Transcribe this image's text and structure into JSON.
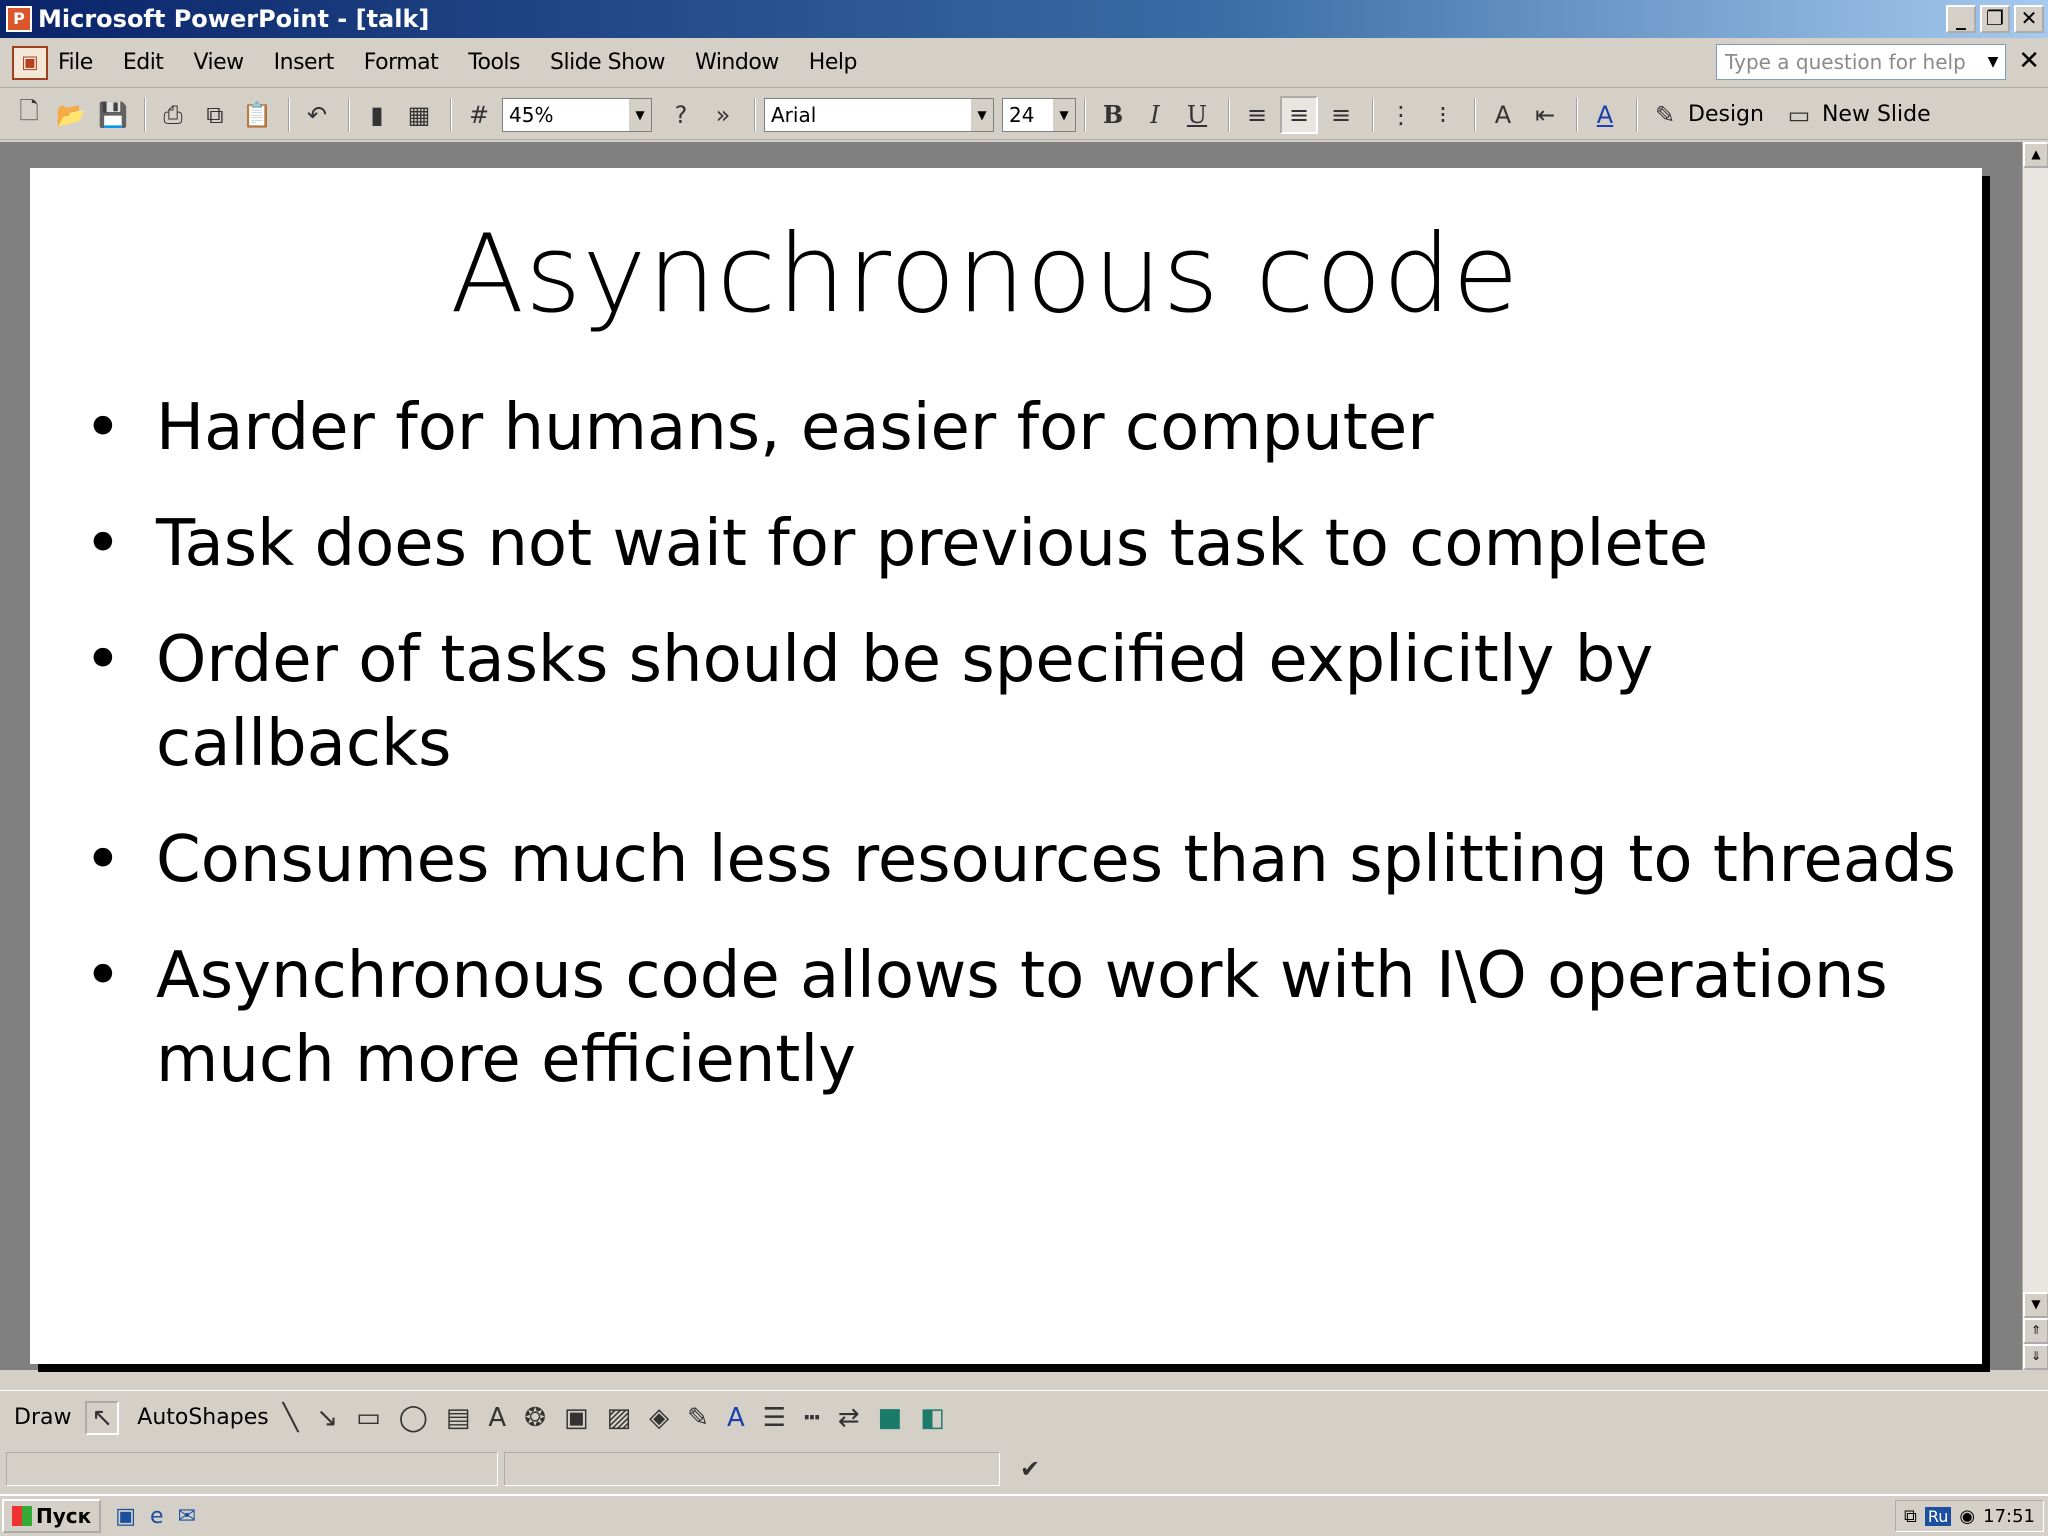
{
  "window": {
    "title": "Microsoft PowerPoint - [talk]",
    "controls": {
      "minimize": "_",
      "restore": "❐",
      "close": "✕"
    }
  },
  "menu": {
    "items": [
      "File",
      "Edit",
      "View",
      "Insert",
      "Format",
      "Tools",
      "Slide Show",
      "Window",
      "Help"
    ],
    "help_placeholder": "Type a question for help",
    "doc_close": "✕"
  },
  "toolbar": {
    "zoom": "45%",
    "font": "Arial",
    "size": "24",
    "bold": "B",
    "italic": "I",
    "underline": "U",
    "design": "Design",
    "new_slide": "New Slide"
  },
  "slide": {
    "title": "Asynchronous code",
    "bullets": [
      "Harder for humans, easier for computer",
      "Task does not wait for previous task to complete",
      "Order of tasks should be specified explicitly by callbacks",
      "Consumes much less resources than splitting to threads",
      "Asynchronous code allows to work with I\\O operations much more efficiently"
    ]
  },
  "drawing_toolbar": {
    "draw": "Draw",
    "autoshapes": "AutoShapes"
  },
  "taskbar": {
    "start": "Пуск",
    "lang": "Ru",
    "clock": "17:51"
  }
}
